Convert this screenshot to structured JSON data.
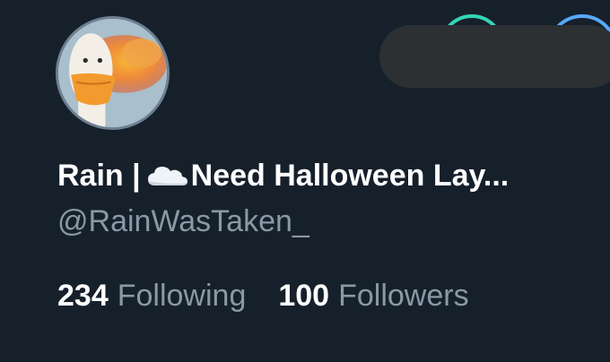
{
  "profile": {
    "name_prefix": "Rain |",
    "name_icon": "cloud-icon",
    "name_suffix": "Need Halloween Lay...",
    "handle": "@RainWasTaken_",
    "following_count": "234",
    "following_label": "Following",
    "followers_count": "100",
    "followers_label": "Followers"
  },
  "colors": {
    "background": "#16202b",
    "primary_text": "#ffffff",
    "secondary_text": "#8b98a5",
    "green_ring": "#33d6b6",
    "blue_ring": "#58a9ff",
    "redaction": "#2c3033"
  }
}
